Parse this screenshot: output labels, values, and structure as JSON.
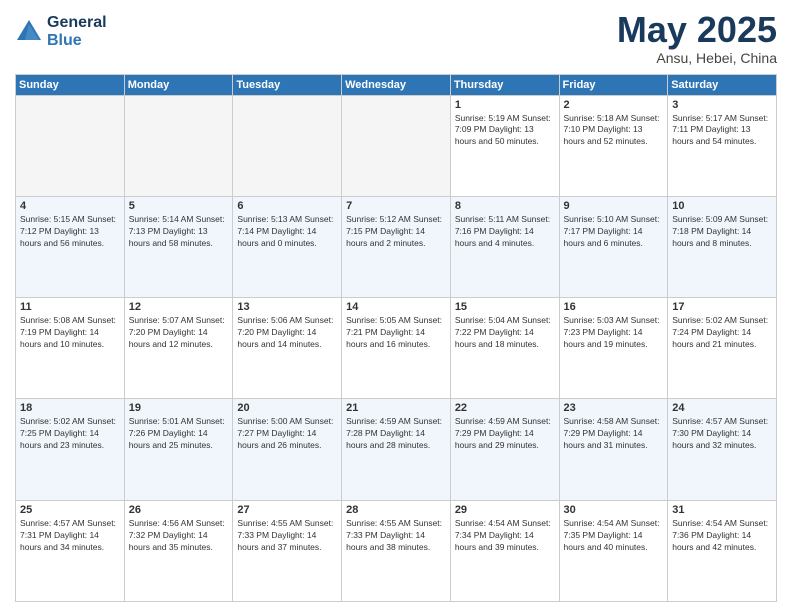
{
  "header": {
    "logo_line1": "General",
    "logo_line2": "Blue",
    "title": "May 2025",
    "subtitle": "Ansu, Hebei, China"
  },
  "weekdays": [
    "Sunday",
    "Monday",
    "Tuesday",
    "Wednesday",
    "Thursday",
    "Friday",
    "Saturday"
  ],
  "weeks": [
    {
      "alt": false,
      "days": [
        {
          "num": "",
          "info": ""
        },
        {
          "num": "",
          "info": ""
        },
        {
          "num": "",
          "info": ""
        },
        {
          "num": "",
          "info": ""
        },
        {
          "num": "1",
          "info": "Sunrise: 5:19 AM\nSunset: 7:09 PM\nDaylight: 13 hours\nand 50 minutes."
        },
        {
          "num": "2",
          "info": "Sunrise: 5:18 AM\nSunset: 7:10 PM\nDaylight: 13 hours\nand 52 minutes."
        },
        {
          "num": "3",
          "info": "Sunrise: 5:17 AM\nSunset: 7:11 PM\nDaylight: 13 hours\nand 54 minutes."
        }
      ]
    },
    {
      "alt": true,
      "days": [
        {
          "num": "4",
          "info": "Sunrise: 5:15 AM\nSunset: 7:12 PM\nDaylight: 13 hours\nand 56 minutes."
        },
        {
          "num": "5",
          "info": "Sunrise: 5:14 AM\nSunset: 7:13 PM\nDaylight: 13 hours\nand 58 minutes."
        },
        {
          "num": "6",
          "info": "Sunrise: 5:13 AM\nSunset: 7:14 PM\nDaylight: 14 hours\nand 0 minutes."
        },
        {
          "num": "7",
          "info": "Sunrise: 5:12 AM\nSunset: 7:15 PM\nDaylight: 14 hours\nand 2 minutes."
        },
        {
          "num": "8",
          "info": "Sunrise: 5:11 AM\nSunset: 7:16 PM\nDaylight: 14 hours\nand 4 minutes."
        },
        {
          "num": "9",
          "info": "Sunrise: 5:10 AM\nSunset: 7:17 PM\nDaylight: 14 hours\nand 6 minutes."
        },
        {
          "num": "10",
          "info": "Sunrise: 5:09 AM\nSunset: 7:18 PM\nDaylight: 14 hours\nand 8 minutes."
        }
      ]
    },
    {
      "alt": false,
      "days": [
        {
          "num": "11",
          "info": "Sunrise: 5:08 AM\nSunset: 7:19 PM\nDaylight: 14 hours\nand 10 minutes."
        },
        {
          "num": "12",
          "info": "Sunrise: 5:07 AM\nSunset: 7:20 PM\nDaylight: 14 hours\nand 12 minutes."
        },
        {
          "num": "13",
          "info": "Sunrise: 5:06 AM\nSunset: 7:20 PM\nDaylight: 14 hours\nand 14 minutes."
        },
        {
          "num": "14",
          "info": "Sunrise: 5:05 AM\nSunset: 7:21 PM\nDaylight: 14 hours\nand 16 minutes."
        },
        {
          "num": "15",
          "info": "Sunrise: 5:04 AM\nSunset: 7:22 PM\nDaylight: 14 hours\nand 18 minutes."
        },
        {
          "num": "16",
          "info": "Sunrise: 5:03 AM\nSunset: 7:23 PM\nDaylight: 14 hours\nand 19 minutes."
        },
        {
          "num": "17",
          "info": "Sunrise: 5:02 AM\nSunset: 7:24 PM\nDaylight: 14 hours\nand 21 minutes."
        }
      ]
    },
    {
      "alt": true,
      "days": [
        {
          "num": "18",
          "info": "Sunrise: 5:02 AM\nSunset: 7:25 PM\nDaylight: 14 hours\nand 23 minutes."
        },
        {
          "num": "19",
          "info": "Sunrise: 5:01 AM\nSunset: 7:26 PM\nDaylight: 14 hours\nand 25 minutes."
        },
        {
          "num": "20",
          "info": "Sunrise: 5:00 AM\nSunset: 7:27 PM\nDaylight: 14 hours\nand 26 minutes."
        },
        {
          "num": "21",
          "info": "Sunrise: 4:59 AM\nSunset: 7:28 PM\nDaylight: 14 hours\nand 28 minutes."
        },
        {
          "num": "22",
          "info": "Sunrise: 4:59 AM\nSunset: 7:29 PM\nDaylight: 14 hours\nand 29 minutes."
        },
        {
          "num": "23",
          "info": "Sunrise: 4:58 AM\nSunset: 7:29 PM\nDaylight: 14 hours\nand 31 minutes."
        },
        {
          "num": "24",
          "info": "Sunrise: 4:57 AM\nSunset: 7:30 PM\nDaylight: 14 hours\nand 32 minutes."
        }
      ]
    },
    {
      "alt": false,
      "days": [
        {
          "num": "25",
          "info": "Sunrise: 4:57 AM\nSunset: 7:31 PM\nDaylight: 14 hours\nand 34 minutes."
        },
        {
          "num": "26",
          "info": "Sunrise: 4:56 AM\nSunset: 7:32 PM\nDaylight: 14 hours\nand 35 minutes."
        },
        {
          "num": "27",
          "info": "Sunrise: 4:55 AM\nSunset: 7:33 PM\nDaylight: 14 hours\nand 37 minutes."
        },
        {
          "num": "28",
          "info": "Sunrise: 4:55 AM\nSunset: 7:33 PM\nDaylight: 14 hours\nand 38 minutes."
        },
        {
          "num": "29",
          "info": "Sunrise: 4:54 AM\nSunset: 7:34 PM\nDaylight: 14 hours\nand 39 minutes."
        },
        {
          "num": "30",
          "info": "Sunrise: 4:54 AM\nSunset: 7:35 PM\nDaylight: 14 hours\nand 40 minutes."
        },
        {
          "num": "31",
          "info": "Sunrise: 4:54 AM\nSunset: 7:36 PM\nDaylight: 14 hours\nand 42 minutes."
        }
      ]
    }
  ]
}
